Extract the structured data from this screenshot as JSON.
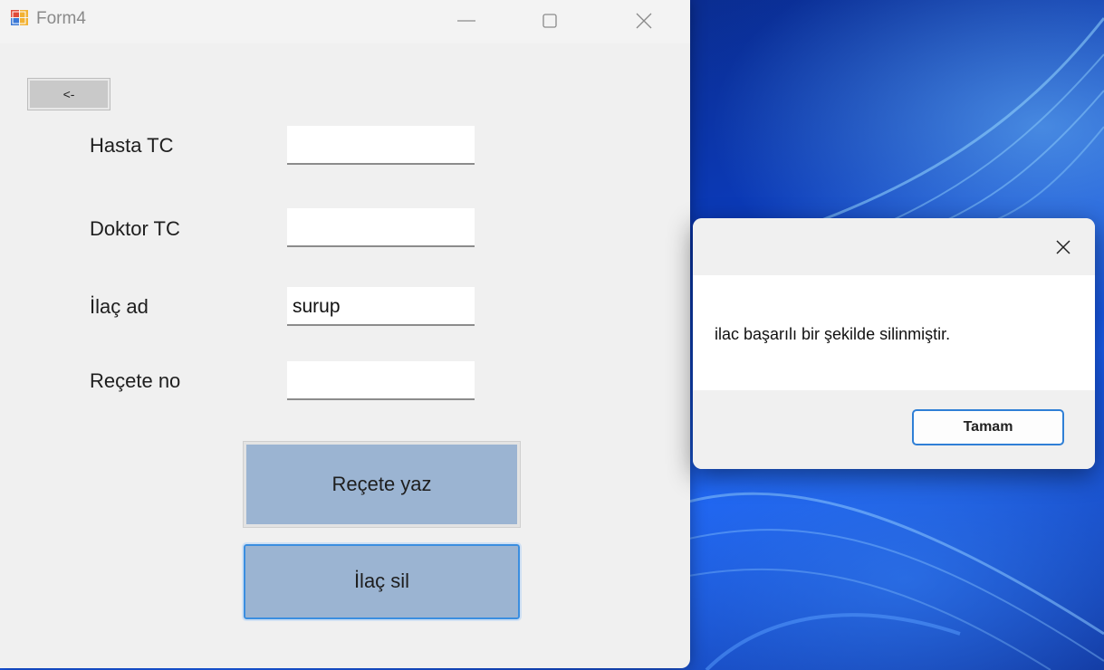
{
  "form": {
    "title": "Form4",
    "back_label": "<-",
    "fields": [
      {
        "label": "Hasta TC",
        "value": ""
      },
      {
        "label": "Doktor TC",
        "value": ""
      },
      {
        "label": "İlaç ad",
        "value": "surup"
      },
      {
        "label": "Reçete no",
        "value": ""
      }
    ],
    "buttons": {
      "write_prescription": "Reçete yaz",
      "delete_drug": "İlaç sil"
    }
  },
  "message_box": {
    "text": "ilac başarılı bir şekilde silinmiştir.",
    "ok_label": "Tamam"
  },
  "icons": {
    "app": "form-app-icon",
    "minimize": "minimize-icon",
    "maximize": "maximize-icon",
    "close": "close-icon"
  },
  "colors": {
    "button_fill": "#9bb4d2",
    "focus_border": "#2f7fd6"
  }
}
